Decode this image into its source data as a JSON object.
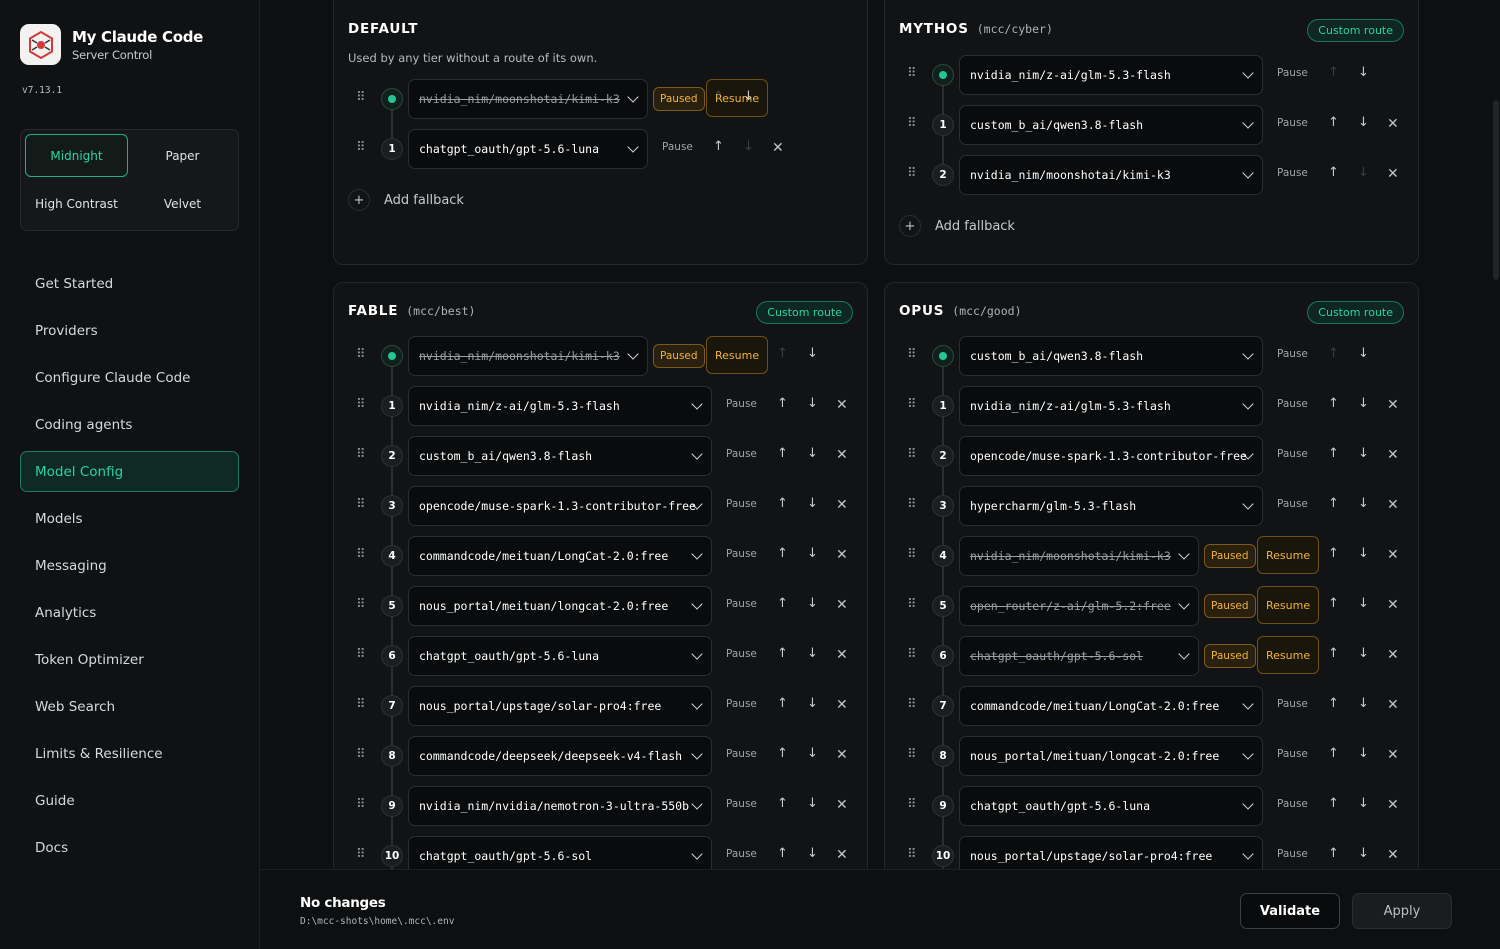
{
  "app": {
    "title": "My Claude Code",
    "subtitle": "Server Control",
    "version": "v7.13.1"
  },
  "themes": [
    "Midnight",
    "Paper",
    "High Contrast",
    "Velvet"
  ],
  "active_theme": "Midnight",
  "nav": [
    "Get Started",
    "Providers",
    "Configure Claude Code",
    "Coding agents",
    "Model Config",
    "Models",
    "Messaging",
    "Analytics",
    "Token Optimizer",
    "Web Search",
    "Limits & Resilience",
    "Guide",
    "Docs"
  ],
  "active_nav": "Model Config",
  "labels": {
    "pause": "Pause",
    "paused": "Paused",
    "resume": "Resume",
    "add_fallback": "Add fallback",
    "custom_route": "Custom route"
  },
  "cards": [
    {
      "name": "DEFAULT",
      "alias": "",
      "desc": "Used by any tier without a route of its own.",
      "badge": "",
      "rows": [
        {
          "idx": "",
          "model": "nvidia_nim/moonshotai/kimi-k3",
          "paused": true
        },
        {
          "idx": "1",
          "model": "chatgpt_oauth/gpt-5.6-luna",
          "paused": false
        }
      ],
      "add_fallback": true
    },
    {
      "name": "MYTHOS",
      "alias": "(mcc/cyber)",
      "desc": "",
      "badge": "Custom route",
      "rows": [
        {
          "idx": "",
          "model": "nvidia_nim/z-ai/glm-5.3-flash",
          "paused": false
        },
        {
          "idx": "1",
          "model": "custom_b_ai/qwen3.8-flash",
          "paused": false
        },
        {
          "idx": "2",
          "model": "nvidia_nim/moonshotai/kimi-k3",
          "paused": false
        }
      ],
      "add_fallback": true
    },
    {
      "name": "FABLE",
      "alias": "(mcc/best)",
      "desc": "",
      "badge": "Custom route",
      "rows": [
        {
          "idx": "",
          "model": "nvidia_nim/moonshotai/kimi-k3",
          "paused": true
        },
        {
          "idx": "1",
          "model": "nvidia_nim/z-ai/glm-5.3-flash",
          "paused": false
        },
        {
          "idx": "2",
          "model": "custom_b_ai/qwen3.8-flash",
          "paused": false
        },
        {
          "idx": "3",
          "model": "opencode/muse-spark-1.3-contributor-free",
          "paused": false
        },
        {
          "idx": "4",
          "model": "commandcode/meituan/LongCat-2.0:free",
          "paused": false
        },
        {
          "idx": "5",
          "model": "nous_portal/meituan/longcat-2.0:free",
          "paused": false
        },
        {
          "idx": "6",
          "model": "chatgpt_oauth/gpt-5.6-luna",
          "paused": false
        },
        {
          "idx": "7",
          "model": "nous_portal/upstage/solar-pro4:free",
          "paused": false
        },
        {
          "idx": "8",
          "model": "commandcode/deepseek/deepseek-v4-flash",
          "paused": false
        },
        {
          "idx": "9",
          "model": "nvidia_nim/nvidia/nemotron-3-ultra-550b",
          "paused": false
        },
        {
          "idx": "10",
          "model": "chatgpt_oauth/gpt-5.6-sol",
          "paused": false
        }
      ],
      "add_fallback": false
    },
    {
      "name": "OPUS",
      "alias": "(mcc/good)",
      "desc": "",
      "badge": "Custom route",
      "rows": [
        {
          "idx": "",
          "model": "custom_b_ai/qwen3.8-flash",
          "paused": false
        },
        {
          "idx": "1",
          "model": "nvidia_nim/z-ai/glm-5.3-flash",
          "paused": false
        },
        {
          "idx": "2",
          "model": "opencode/muse-spark-1.3-contributor-free",
          "paused": false
        },
        {
          "idx": "3",
          "model": "hypercharm/glm-5.3-flash",
          "paused": false
        },
        {
          "idx": "4",
          "model": "nvidia_nim/moonshotai/kimi-k3",
          "paused": true
        },
        {
          "idx": "5",
          "model": "open_router/z-ai/glm-5.2:free",
          "paused": true
        },
        {
          "idx": "6",
          "model": "chatgpt_oauth/gpt-5.6-sol",
          "paused": true
        },
        {
          "idx": "7",
          "model": "commandcode/meituan/LongCat-2.0:free",
          "paused": false
        },
        {
          "idx": "8",
          "model": "nous_portal/meituan/longcat-2.0:free",
          "paused": false
        },
        {
          "idx": "9",
          "model": "chatgpt_oauth/gpt-5.6-luna",
          "paused": false
        },
        {
          "idx": "10",
          "model": "nous_portal/upstage/solar-pro4:free",
          "paused": false
        }
      ],
      "add_fallback": false
    }
  ],
  "footer": {
    "status": "No changes",
    "path": "D:\\mcc-shots\\home\\.mcc\\.env",
    "validate": "Validate",
    "apply": "Apply"
  },
  "colors": {
    "accent": "#2cd3a4",
    "paused": "#f0b43a",
    "background": "#0d0f11"
  }
}
